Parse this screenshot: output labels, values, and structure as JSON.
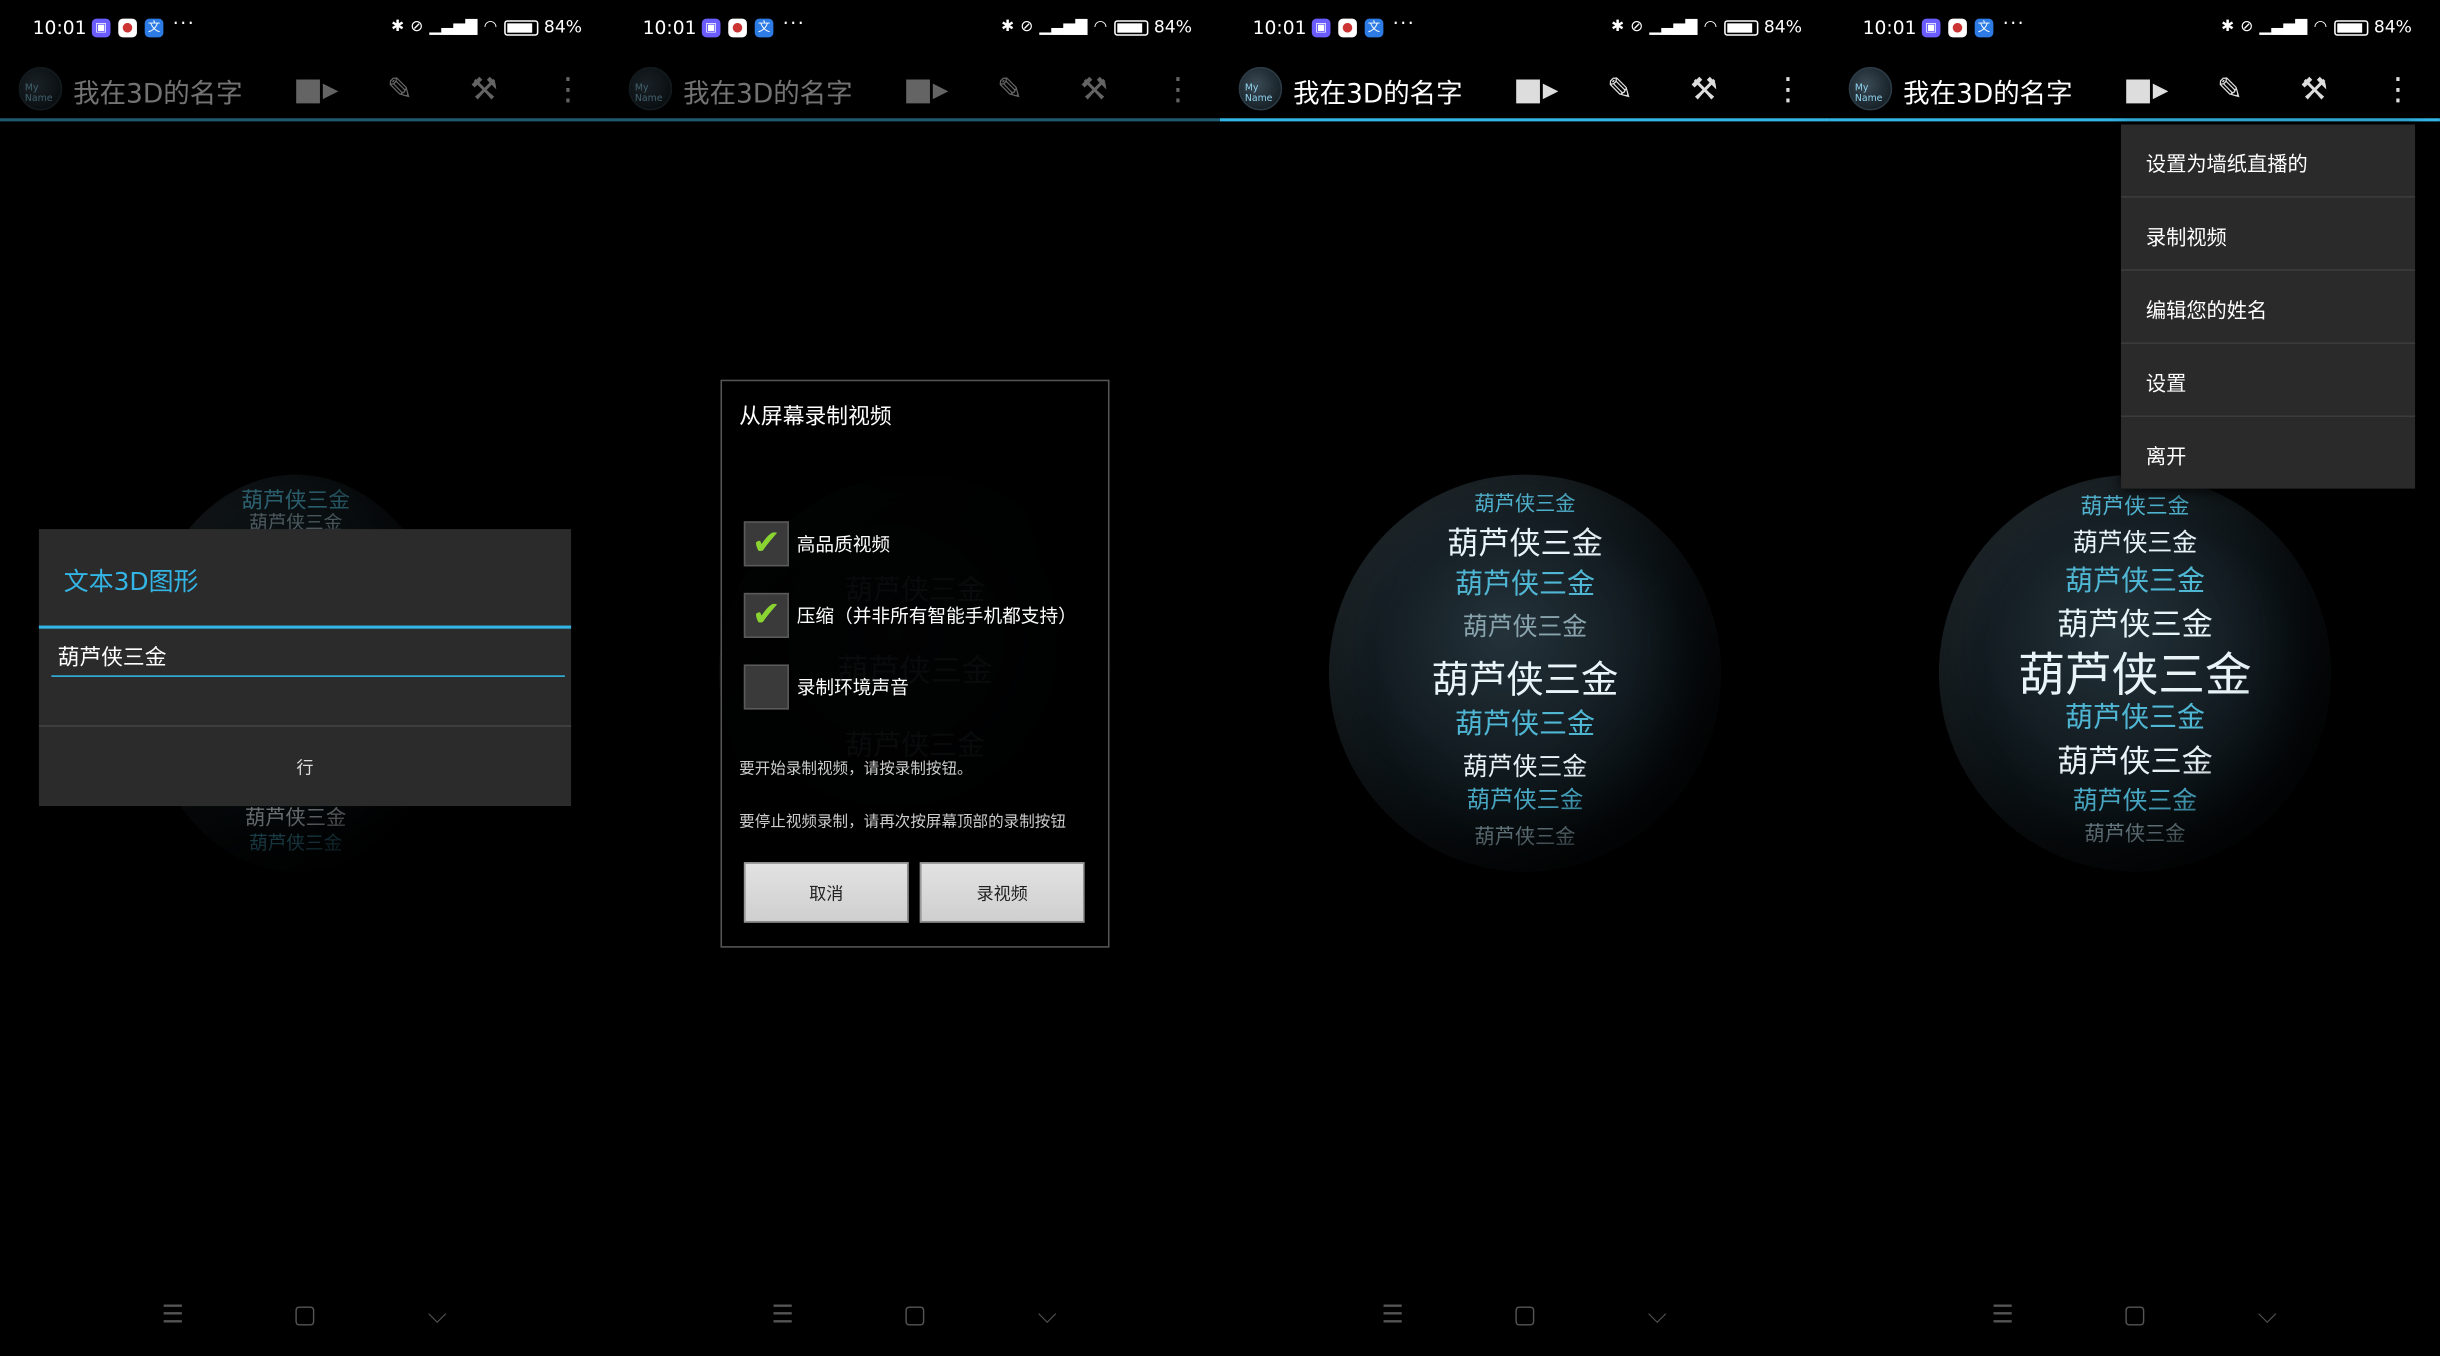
{
  "status_bar": {
    "time": "10:01",
    "dots": "···",
    "battery": "84%"
  },
  "action_bar": {
    "title": "我在3D的名字",
    "icon_text": "My Name"
  },
  "icons": {
    "video": "video-camera-icon",
    "edit": "pencil-icon",
    "settings": "wrench-icon",
    "overflow": "overflow-menu-icon"
  },
  "panel1": {
    "dialog_title": "文本3D图形",
    "input_value": "葫芦侠三金",
    "ok_label": "行"
  },
  "panel2": {
    "dialog_title": "从屏幕录制视频",
    "options": [
      {
        "label": "高品质视频",
        "checked": true
      },
      {
        "label": "压缩（并非所有智能手机都支持）",
        "checked": true
      },
      {
        "label": "录制环境声音",
        "checked": false
      }
    ],
    "note_start": "要开始录制视频，请按录制按钮。",
    "note_stop": "要停止视频录制，请再次按屏幕顶部的录制按钮",
    "cancel_label": "取消",
    "record_label": "录视频"
  },
  "panel4": {
    "menu_items": [
      "设置为墙纸直播的",
      "录制视频",
      "编辑您的姓名",
      "设置",
      "离开"
    ]
  },
  "sphere_text": "葫芦侠三金",
  "colors": {
    "accent": "#33b5e5",
    "check": "#8ad431",
    "dialog_bg": "#2b2b2b"
  }
}
